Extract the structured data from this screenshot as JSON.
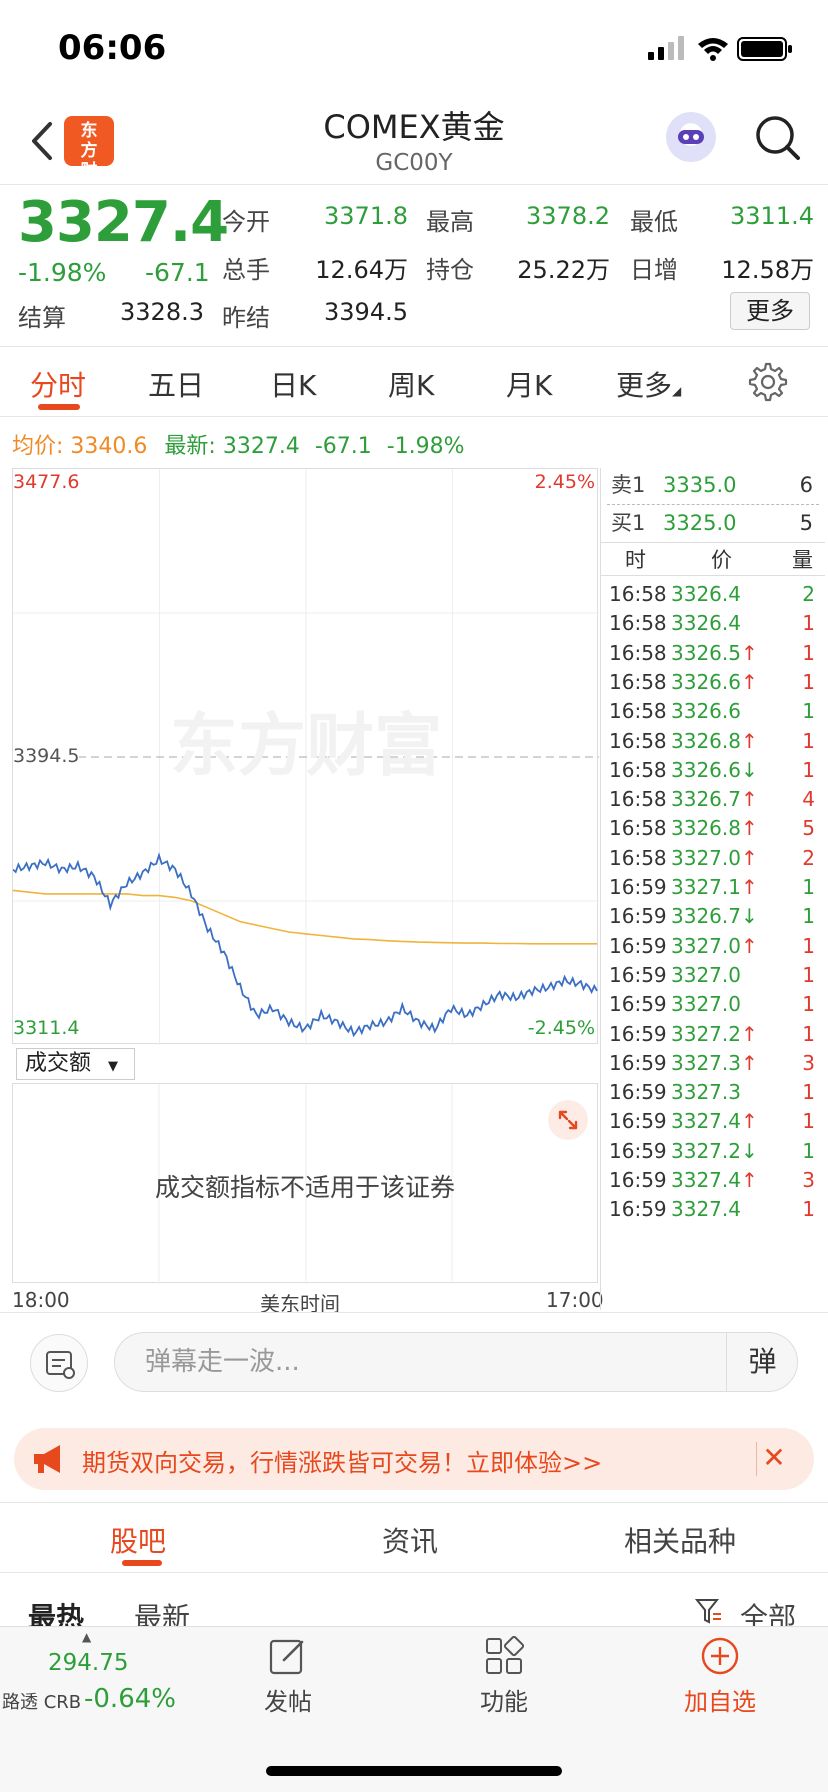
{
  "status_bar": {
    "time": "06:06"
  },
  "header": {
    "title": "COMEX黄金",
    "subtitle": "GC00Y",
    "logo_text": "东方财富"
  },
  "quote": {
    "price": "3327.4",
    "change_pct": "-1.98%",
    "change_abs": "-67.1",
    "fields": [
      {
        "label": "今开",
        "value": "3371.8",
        "color": "green"
      },
      {
        "label": "最高",
        "value": "3378.2",
        "color": "green"
      },
      {
        "label": "最低",
        "value": "3311.4",
        "color": "green"
      },
      {
        "label": "总手",
        "value": "12.64万",
        "color": "dark"
      },
      {
        "label": "持仓",
        "value": "25.22万",
        "color": "dark"
      },
      {
        "label": "日增",
        "value": "12.58万",
        "color": "dark"
      },
      {
        "label": "结算",
        "value": "3328.3",
        "color": "dark"
      },
      {
        "label": "昨结",
        "value": "3394.5",
        "color": "dark"
      }
    ],
    "more_label": "更多"
  },
  "tabs": [
    "分时",
    "五日",
    "日K",
    "周K",
    "月K",
    "更多"
  ],
  "info_line": {
    "avg_label": "均价:",
    "avg_value": "3340.6",
    "latest_label": "最新:",
    "latest_value": "3327.4",
    "latest_change": "-67.1",
    "latest_pct": "-1.98%"
  },
  "chart_data": {
    "type": "line",
    "y_top": "3477.6",
    "y_bottom": "3311.4",
    "y_ref": "3394.5",
    "pct_top": "2.45%",
    "pct_bottom": "-2.45%",
    "watermark": "东方财富",
    "ylim": [
      3311.4,
      3477.6
    ],
    "x_labels": [
      "18:00",
      "美东时间",
      "17:00"
    ],
    "series": [
      {
        "role": "price",
        "color": "#3a6fc4",
        "values": [
          3362,
          3363,
          3364,
          3362,
          3363,
          3360,
          3352,
          3358,
          3361,
          3365,
          3362,
          3355,
          3345,
          3338,
          3328,
          3320,
          3322,
          3318,
          3316,
          3320,
          3318,
          3315,
          3317,
          3318,
          3322,
          3318,
          3316,
          3322,
          3320,
          3323,
          3326,
          3325,
          3327,
          3328,
          3330,
          3329,
          3327
        ]
      },
      {
        "role": "average",
        "color": "#f0b43c",
        "values": [
          3356,
          3355.5,
          3355,
          3355,
          3355,
          3355,
          3355,
          3355,
          3354.5,
          3354.5,
          3354,
          3353,
          3351,
          3349,
          3347,
          3346,
          3345,
          3344,
          3343.5,
          3343,
          3342.5,
          3342,
          3341.8,
          3341.5,
          3341.3,
          3341.1,
          3341,
          3340.9,
          3340.8,
          3340.8,
          3340.7,
          3340.7,
          3340.6,
          3340.6,
          3340.6,
          3340.6,
          3340.6
        ]
      }
    ]
  },
  "volume_panel": {
    "selector_label": "成交额",
    "message": "成交额指标不适用于该证券"
  },
  "order_book": {
    "ask": {
      "label": "卖1",
      "price": "3335.0",
      "qty": "6"
    },
    "bid": {
      "label": "买1",
      "price": "3325.0",
      "qty": "5"
    },
    "headers": [
      "时",
      "价",
      "量"
    ]
  },
  "ticks": [
    {
      "time": "16:58",
      "price": "3326.4",
      "arrow": "",
      "vol": "2",
      "pc": "green",
      "vc": "green"
    },
    {
      "time": "16:58",
      "price": "3326.4",
      "arrow": "",
      "vol": "1",
      "pc": "green",
      "vc": "red"
    },
    {
      "time": "16:58",
      "price": "3326.5",
      "arrow": "↑",
      "vol": "1",
      "pc": "green",
      "vc": "red"
    },
    {
      "time": "16:58",
      "price": "3326.6",
      "arrow": "↑",
      "vol": "1",
      "pc": "green",
      "vc": "red"
    },
    {
      "time": "16:58",
      "price": "3326.6",
      "arrow": "",
      "vol": "1",
      "pc": "green",
      "vc": "green"
    },
    {
      "time": "16:58",
      "price": "3326.8",
      "arrow": "↑",
      "vol": "1",
      "pc": "green",
      "vc": "red"
    },
    {
      "time": "16:58",
      "price": "3326.6",
      "arrow": "↓",
      "vol": "1",
      "pc": "green",
      "vc": "red"
    },
    {
      "time": "16:58",
      "price": "3326.7",
      "arrow": "↑",
      "vol": "4",
      "pc": "green",
      "vc": "red"
    },
    {
      "time": "16:58",
      "price": "3326.8",
      "arrow": "↑",
      "vol": "5",
      "pc": "green",
      "vc": "red"
    },
    {
      "time": "16:58",
      "price": "3327.0",
      "arrow": "↑",
      "vol": "2",
      "pc": "green",
      "vc": "red"
    },
    {
      "time": "16:59",
      "price": "3327.1",
      "arrow": "↑",
      "vol": "1",
      "pc": "green",
      "vc": "green"
    },
    {
      "time": "16:59",
      "price": "3326.7",
      "arrow": "↓",
      "vol": "1",
      "pc": "green",
      "vc": "green"
    },
    {
      "time": "16:59",
      "price": "3327.0",
      "arrow": "↑",
      "vol": "1",
      "pc": "green",
      "vc": "red"
    },
    {
      "time": "16:59",
      "price": "3327.0",
      "arrow": "",
      "vol": "1",
      "pc": "green",
      "vc": "red"
    },
    {
      "time": "16:59",
      "price": "3327.0",
      "arrow": "",
      "vol": "1",
      "pc": "green",
      "vc": "red"
    },
    {
      "time": "16:59",
      "price": "3327.2",
      "arrow": "↑",
      "vol": "1",
      "pc": "green",
      "vc": "red"
    },
    {
      "time": "16:59",
      "price": "3327.3",
      "arrow": "↑",
      "vol": "3",
      "pc": "green",
      "vc": "red"
    },
    {
      "time": "16:59",
      "price": "3327.3",
      "arrow": "",
      "vol": "1",
      "pc": "green",
      "vc": "red"
    },
    {
      "time": "16:59",
      "price": "3327.4",
      "arrow": "↑",
      "vol": "1",
      "pc": "green",
      "vc": "red"
    },
    {
      "time": "16:59",
      "price": "3327.2",
      "arrow": "↓",
      "vol": "1",
      "pc": "green",
      "vc": "green"
    },
    {
      "time": "16:59",
      "price": "3327.4",
      "arrow": "↑",
      "vol": "3",
      "pc": "green",
      "vc": "red"
    },
    {
      "time": "16:59",
      "price": "3327.4",
      "arrow": "",
      "vol": "1",
      "pc": "green",
      "vc": "red"
    }
  ],
  "danmaku": {
    "placeholder": "弹幕走一波...",
    "send_label": "弹"
  },
  "promo": {
    "text": "期货双向交易，行情涨跌皆可交易！立即体验>>",
    "close": "✕"
  },
  "bottom_tabs": [
    "股吧",
    "资讯",
    "相关品种"
  ],
  "sub_tabs": {
    "hot": "最热",
    "latest": "最新",
    "filter": "全部"
  },
  "toolbar": {
    "crb_value": "294.75",
    "crb_label": "路透 CRB",
    "crb_change": "-0.64%",
    "post_label": "发帖",
    "func_label": "功能",
    "add_label": "加自选"
  },
  "colors": {
    "brand": "#e8481e",
    "down": "#2e9e3a",
    "up": "#e03a2f",
    "price_line": "#3a6fc4",
    "avg_line": "#f0b43c"
  }
}
